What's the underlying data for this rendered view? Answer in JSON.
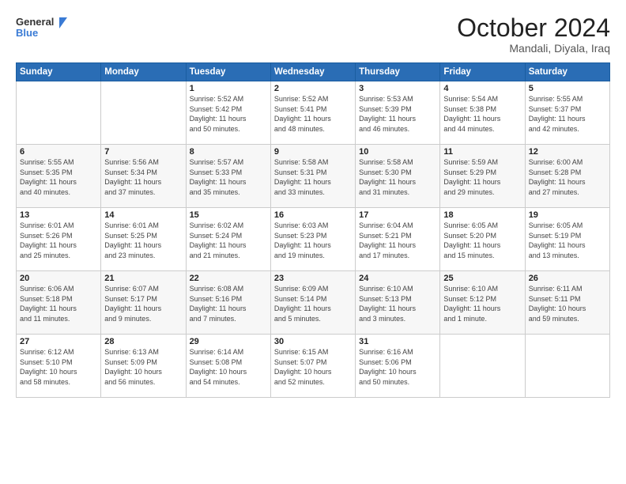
{
  "logo": {
    "general": "General",
    "blue": "Blue"
  },
  "header": {
    "month": "October 2024",
    "location": "Mandali, Diyala, Iraq"
  },
  "weekdays": [
    "Sunday",
    "Monday",
    "Tuesday",
    "Wednesday",
    "Thursday",
    "Friday",
    "Saturday"
  ],
  "weeks": [
    [
      {
        "day": "",
        "info": ""
      },
      {
        "day": "",
        "info": ""
      },
      {
        "day": "1",
        "info": "Sunrise: 5:52 AM\nSunset: 5:42 PM\nDaylight: 11 hours\nand 50 minutes."
      },
      {
        "day": "2",
        "info": "Sunrise: 5:52 AM\nSunset: 5:41 PM\nDaylight: 11 hours\nand 48 minutes."
      },
      {
        "day": "3",
        "info": "Sunrise: 5:53 AM\nSunset: 5:39 PM\nDaylight: 11 hours\nand 46 minutes."
      },
      {
        "day": "4",
        "info": "Sunrise: 5:54 AM\nSunset: 5:38 PM\nDaylight: 11 hours\nand 44 minutes."
      },
      {
        "day": "5",
        "info": "Sunrise: 5:55 AM\nSunset: 5:37 PM\nDaylight: 11 hours\nand 42 minutes."
      }
    ],
    [
      {
        "day": "6",
        "info": "Sunrise: 5:55 AM\nSunset: 5:35 PM\nDaylight: 11 hours\nand 40 minutes."
      },
      {
        "day": "7",
        "info": "Sunrise: 5:56 AM\nSunset: 5:34 PM\nDaylight: 11 hours\nand 37 minutes."
      },
      {
        "day": "8",
        "info": "Sunrise: 5:57 AM\nSunset: 5:33 PM\nDaylight: 11 hours\nand 35 minutes."
      },
      {
        "day": "9",
        "info": "Sunrise: 5:58 AM\nSunset: 5:31 PM\nDaylight: 11 hours\nand 33 minutes."
      },
      {
        "day": "10",
        "info": "Sunrise: 5:58 AM\nSunset: 5:30 PM\nDaylight: 11 hours\nand 31 minutes."
      },
      {
        "day": "11",
        "info": "Sunrise: 5:59 AM\nSunset: 5:29 PM\nDaylight: 11 hours\nand 29 minutes."
      },
      {
        "day": "12",
        "info": "Sunrise: 6:00 AM\nSunset: 5:28 PM\nDaylight: 11 hours\nand 27 minutes."
      }
    ],
    [
      {
        "day": "13",
        "info": "Sunrise: 6:01 AM\nSunset: 5:26 PM\nDaylight: 11 hours\nand 25 minutes."
      },
      {
        "day": "14",
        "info": "Sunrise: 6:01 AM\nSunset: 5:25 PM\nDaylight: 11 hours\nand 23 minutes."
      },
      {
        "day": "15",
        "info": "Sunrise: 6:02 AM\nSunset: 5:24 PM\nDaylight: 11 hours\nand 21 minutes."
      },
      {
        "day": "16",
        "info": "Sunrise: 6:03 AM\nSunset: 5:23 PM\nDaylight: 11 hours\nand 19 minutes."
      },
      {
        "day": "17",
        "info": "Sunrise: 6:04 AM\nSunset: 5:21 PM\nDaylight: 11 hours\nand 17 minutes."
      },
      {
        "day": "18",
        "info": "Sunrise: 6:05 AM\nSunset: 5:20 PM\nDaylight: 11 hours\nand 15 minutes."
      },
      {
        "day": "19",
        "info": "Sunrise: 6:05 AM\nSunset: 5:19 PM\nDaylight: 11 hours\nand 13 minutes."
      }
    ],
    [
      {
        "day": "20",
        "info": "Sunrise: 6:06 AM\nSunset: 5:18 PM\nDaylight: 11 hours\nand 11 minutes."
      },
      {
        "day": "21",
        "info": "Sunrise: 6:07 AM\nSunset: 5:17 PM\nDaylight: 11 hours\nand 9 minutes."
      },
      {
        "day": "22",
        "info": "Sunrise: 6:08 AM\nSunset: 5:16 PM\nDaylight: 11 hours\nand 7 minutes."
      },
      {
        "day": "23",
        "info": "Sunrise: 6:09 AM\nSunset: 5:14 PM\nDaylight: 11 hours\nand 5 minutes."
      },
      {
        "day": "24",
        "info": "Sunrise: 6:10 AM\nSunset: 5:13 PM\nDaylight: 11 hours\nand 3 minutes."
      },
      {
        "day": "25",
        "info": "Sunrise: 6:10 AM\nSunset: 5:12 PM\nDaylight: 11 hours\nand 1 minute."
      },
      {
        "day": "26",
        "info": "Sunrise: 6:11 AM\nSunset: 5:11 PM\nDaylight: 10 hours\nand 59 minutes."
      }
    ],
    [
      {
        "day": "27",
        "info": "Sunrise: 6:12 AM\nSunset: 5:10 PM\nDaylight: 10 hours\nand 58 minutes."
      },
      {
        "day": "28",
        "info": "Sunrise: 6:13 AM\nSunset: 5:09 PM\nDaylight: 10 hours\nand 56 minutes."
      },
      {
        "day": "29",
        "info": "Sunrise: 6:14 AM\nSunset: 5:08 PM\nDaylight: 10 hours\nand 54 minutes."
      },
      {
        "day": "30",
        "info": "Sunrise: 6:15 AM\nSunset: 5:07 PM\nDaylight: 10 hours\nand 52 minutes."
      },
      {
        "day": "31",
        "info": "Sunrise: 6:16 AM\nSunset: 5:06 PM\nDaylight: 10 hours\nand 50 minutes."
      },
      {
        "day": "",
        "info": ""
      },
      {
        "day": "",
        "info": ""
      }
    ]
  ]
}
